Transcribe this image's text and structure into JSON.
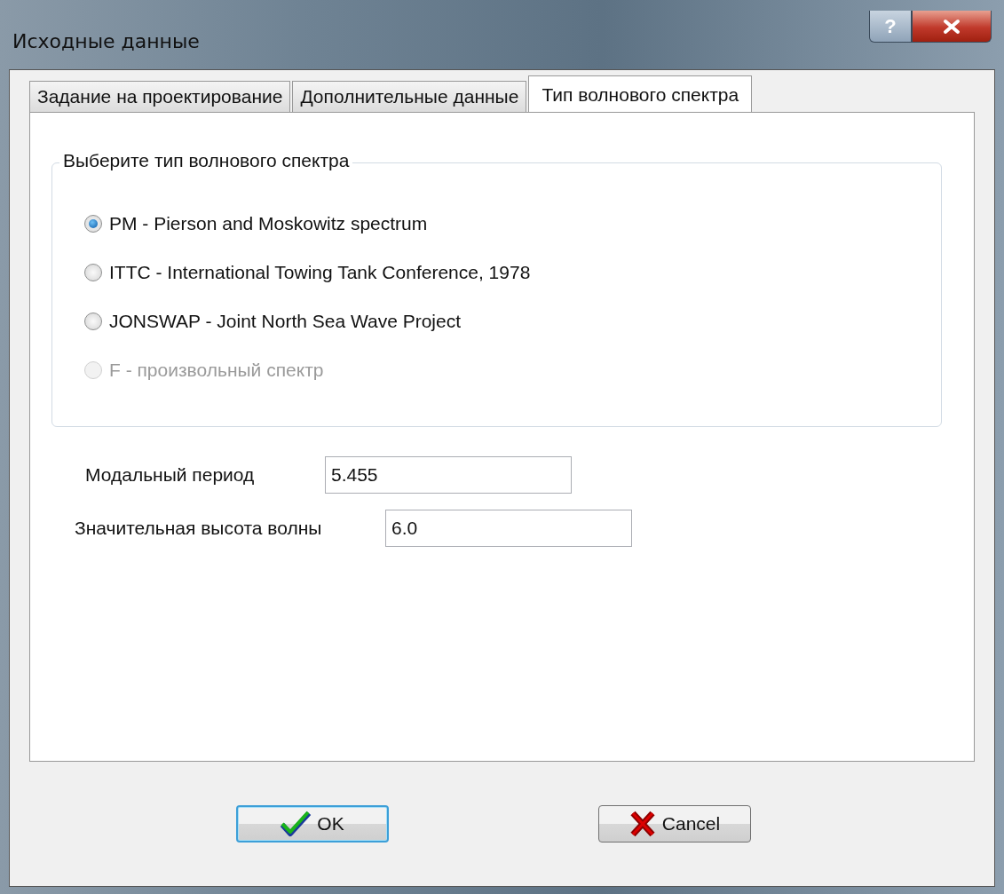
{
  "window": {
    "title": "Исходные данные",
    "help_button": "?"
  },
  "tabs": [
    {
      "label": "Задание на проектирование",
      "selected": false
    },
    {
      "label": "Дополнительные данные",
      "selected": false
    },
    {
      "label": "Тип волнового спектра",
      "selected": true
    }
  ],
  "spectrum_group": {
    "title": "Выберите тип волнового спектра",
    "options": [
      {
        "label": "PM - Pierson and Moskowitz spectrum",
        "selected": true,
        "disabled": false
      },
      {
        "label": "ITTC - International Towing Tank Conference, 1978",
        "selected": false,
        "disabled": false
      },
      {
        "label": "JONSWAP - Joint North Sea Wave Project",
        "selected": false,
        "disabled": false
      },
      {
        "label": "F - произвольный спектр",
        "selected": false,
        "disabled": true
      }
    ]
  },
  "fields": [
    {
      "label": "Модальный период",
      "value": "5.455"
    },
    {
      "label": "Значительная высота волны",
      "value": "6.0"
    }
  ],
  "buttons": [
    {
      "kind": "ok",
      "label": "OK",
      "default": true
    },
    {
      "kind": "cancel",
      "label": "Cancel",
      "default": false
    }
  ]
}
